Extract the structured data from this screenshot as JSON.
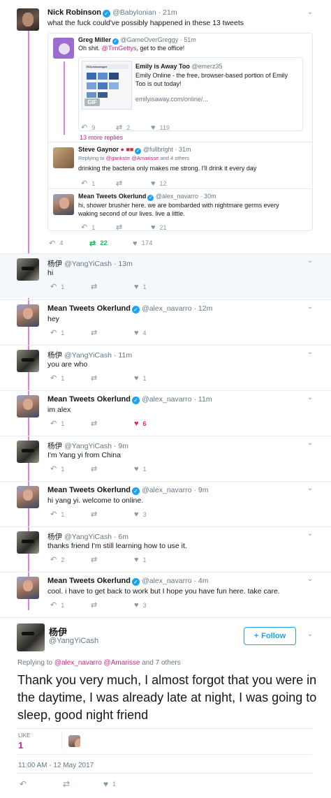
{
  "nick": {
    "name": "Nick Robinson",
    "handle": "@Babylonian",
    "time": "· 21m",
    "text": "what the fuck could've possibly happened in these 13 tweets",
    "replies": "4",
    "retweets": "22",
    "likes": "174"
  },
  "greg": {
    "name": "Greg Miller",
    "handle": "@GameOverGreggy",
    "time": "· 51m",
    "text_a": "Oh shit. ",
    "mention": "@TimGettys",
    "text_b": ", get to the office!",
    "replies": "9",
    "retweets": "2",
    "likes": "119",
    "more": "13 more replies"
  },
  "emily": {
    "name": "Emily is Away Too",
    "handle": "@emerz35",
    "text": "Emily Online - the free, browser-based portion of Emily Too is out today!",
    "link": "emilyisaway.com/online/...",
    "gif": "GIF",
    "thumb_title": "EOLmessenger"
  },
  "steve": {
    "name": "Steve Gaynor",
    "handle": "@fullbright",
    "time": "· 31m",
    "reply_prefix": "Replying to ",
    "reply_mentions": "@gankstrr @Amarisse",
    "reply_suffix": " and 4 others",
    "text": "drinking the bacteria only makes me strong. I'll drink it every day",
    "replies": "1",
    "likes": "12"
  },
  "mean_q": {
    "name": "Mean Tweets Okerlund",
    "handle": "@alex_navarro",
    "time": "· 30m",
    "text": "hi, shower brusher here. we are bombarded with nightmare germs every waking second of our lives. live a little.",
    "replies": "1",
    "likes": "21"
  },
  "tweets": [
    {
      "name": "杨伊",
      "handle": "@YangYiCash",
      "time": "· 13m",
      "text": "hi",
      "replies": "1",
      "likes": "1"
    },
    {
      "name": "Mean Tweets Okerlund",
      "handle": "@alex_navarro",
      "time": "· 12m",
      "text": "hey",
      "replies": "1",
      "likes": "4"
    },
    {
      "name": "杨伊",
      "handle": "@YangYiCash",
      "time": "· 11m",
      "text": "you are who",
      "replies": "1",
      "likes": "1"
    },
    {
      "name": "Mean Tweets Okerlund",
      "handle": "@alex_navarro",
      "time": "· 11m",
      "text": "im alex",
      "replies": "1",
      "likes": "6"
    },
    {
      "name": "杨伊",
      "handle": "@YangYiCash",
      "time": "· 9m",
      "text": "I'm Yang yi from China",
      "replies": "1",
      "likes": "1"
    },
    {
      "name": "Mean Tweets Okerlund",
      "handle": "@alex_navarro",
      "time": "· 9m",
      "text": "hi yang yi. welcome to online.",
      "replies": "1",
      "likes": "3"
    },
    {
      "name": "杨伊",
      "handle": "@YangYiCash",
      "time": "· 6m",
      "text": "thanks friend I'm still learning how to use it.",
      "replies": "2",
      "likes": "1"
    },
    {
      "name": "Mean Tweets Okerlund",
      "handle": "@alex_navarro",
      "time": "· 4m",
      "text": "cool. i have to get back to work but I hope you have fun here. take care.",
      "replies": "1",
      "likes": "3"
    }
  ],
  "main": {
    "name": "杨伊",
    "handle": "@YangYiCash",
    "follow": "Follow",
    "reply_prefix": "Replying to ",
    "reply_mentions": "@alex_navarro @Amarisse",
    "reply_suffix": " and 7 others",
    "text": "Thank you very much, I almost forgot that you were in the daytime, I was already late at night, I was going to sleep, good night friend",
    "like_label": "LIKE",
    "like_count": "1",
    "timestamp": "11:00 AM - 12 May 2017",
    "likes": "1"
  },
  "colors": {
    "accent": "#1da1f2",
    "thread": "#e07fe6",
    "liked": "#e0245e",
    "retweeted": "#17bf63"
  }
}
